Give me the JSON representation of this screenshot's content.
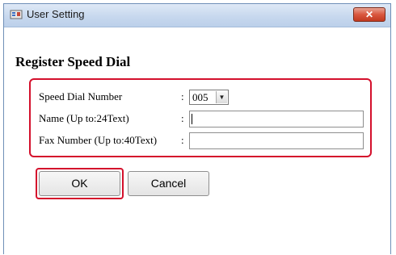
{
  "window": {
    "title": "User Setting",
    "close_glyph": "✕"
  },
  "dialog": {
    "heading": "Register Speed Dial",
    "fields": {
      "speed_dial_label": "Speed Dial Number",
      "speed_dial_value": "005",
      "name_label": "Name (Up to:24Text)",
      "name_value": "",
      "fax_label": "Fax Number (Up to:40Text)",
      "fax_value": ""
    },
    "colon": ":",
    "buttons": {
      "ok": "OK",
      "cancel": "Cancel"
    }
  },
  "colors": {
    "highlight": "#d4102c",
    "titlebar": "#c7d8ee",
    "close_button": "#d9573f"
  },
  "icons": {
    "app": "user-setting-icon",
    "dropdown": "chevron-down-icon"
  }
}
